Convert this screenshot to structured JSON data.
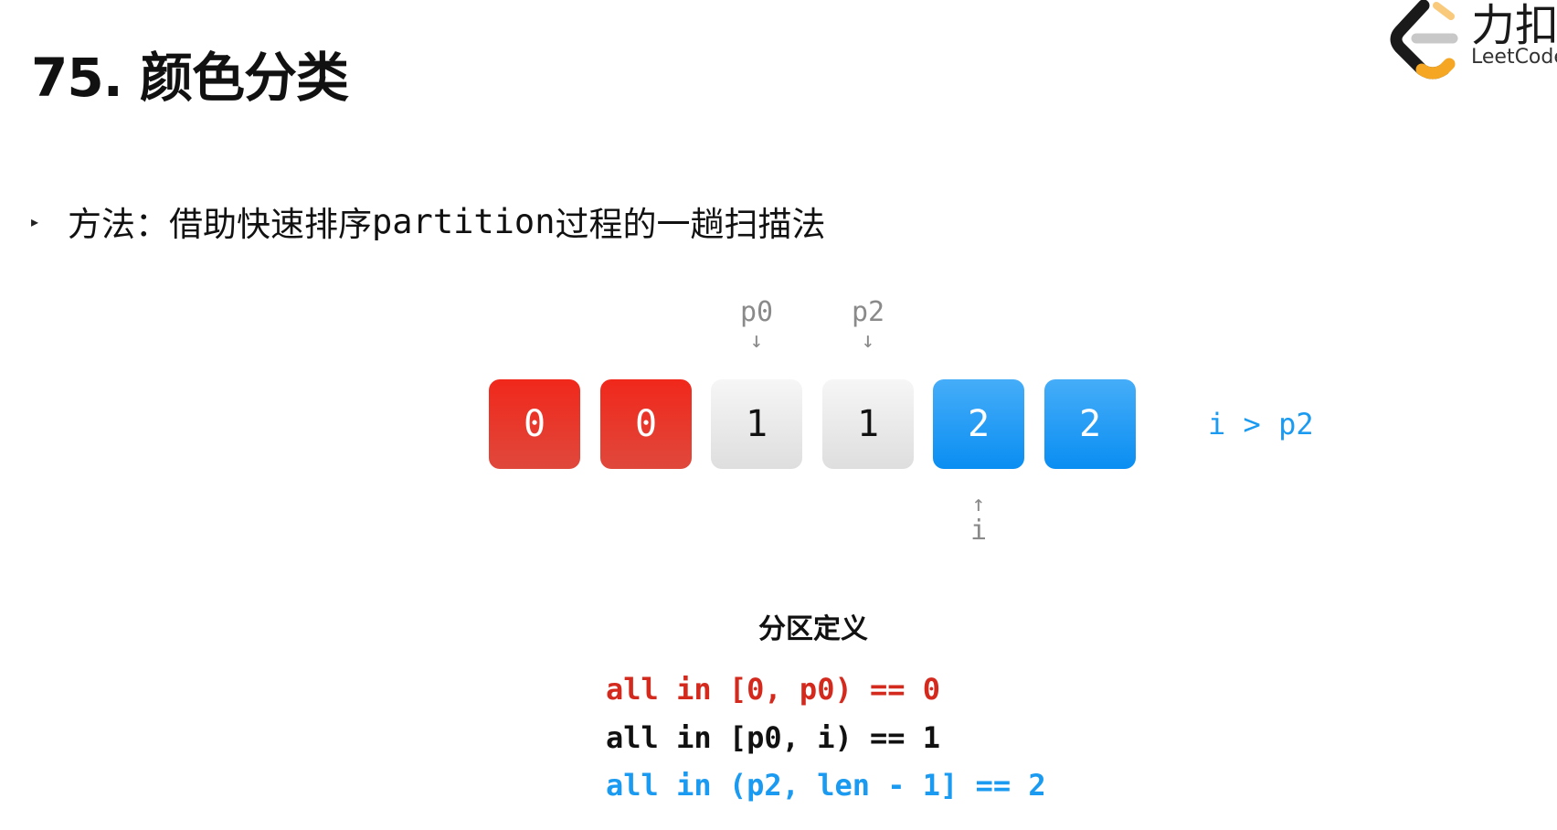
{
  "title": "75. 颜色分类",
  "logo": {
    "cn": "力扣",
    "en": "LeetCode",
    "colors": {
      "orange": "#f5a623",
      "black": "#1a1a1a",
      "gray": "#c8c8c8"
    }
  },
  "bullet": {
    "marker": "▸",
    "text_before": "方法：借助快速排序 ",
    "code": "partition",
    "text_after": " 过程的一趟扫描法"
  },
  "pointers": {
    "p0": {
      "label": "p0",
      "arrow": "↓"
    },
    "p2": {
      "label": "p2",
      "arrow": "↓"
    },
    "i": {
      "label": "i",
      "arrow": "↑"
    }
  },
  "array": [
    {
      "value": "0",
      "color": "red"
    },
    {
      "value": "0",
      "color": "red"
    },
    {
      "value": "1",
      "color": "gray"
    },
    {
      "value": "1",
      "color": "gray"
    },
    {
      "value": "2",
      "color": "blue"
    },
    {
      "value": "2",
      "color": "blue"
    }
  ],
  "condition": "i > p2",
  "section_title": "分区定义",
  "definitions": [
    {
      "text": "all in [0, p0) == 0",
      "color": "#d42a1e"
    },
    {
      "text": "all in [p0, i) == 1",
      "color": "#111111"
    },
    {
      "text": "all in (p2, len - 1] == 2",
      "color": "#1a9af0"
    }
  ]
}
